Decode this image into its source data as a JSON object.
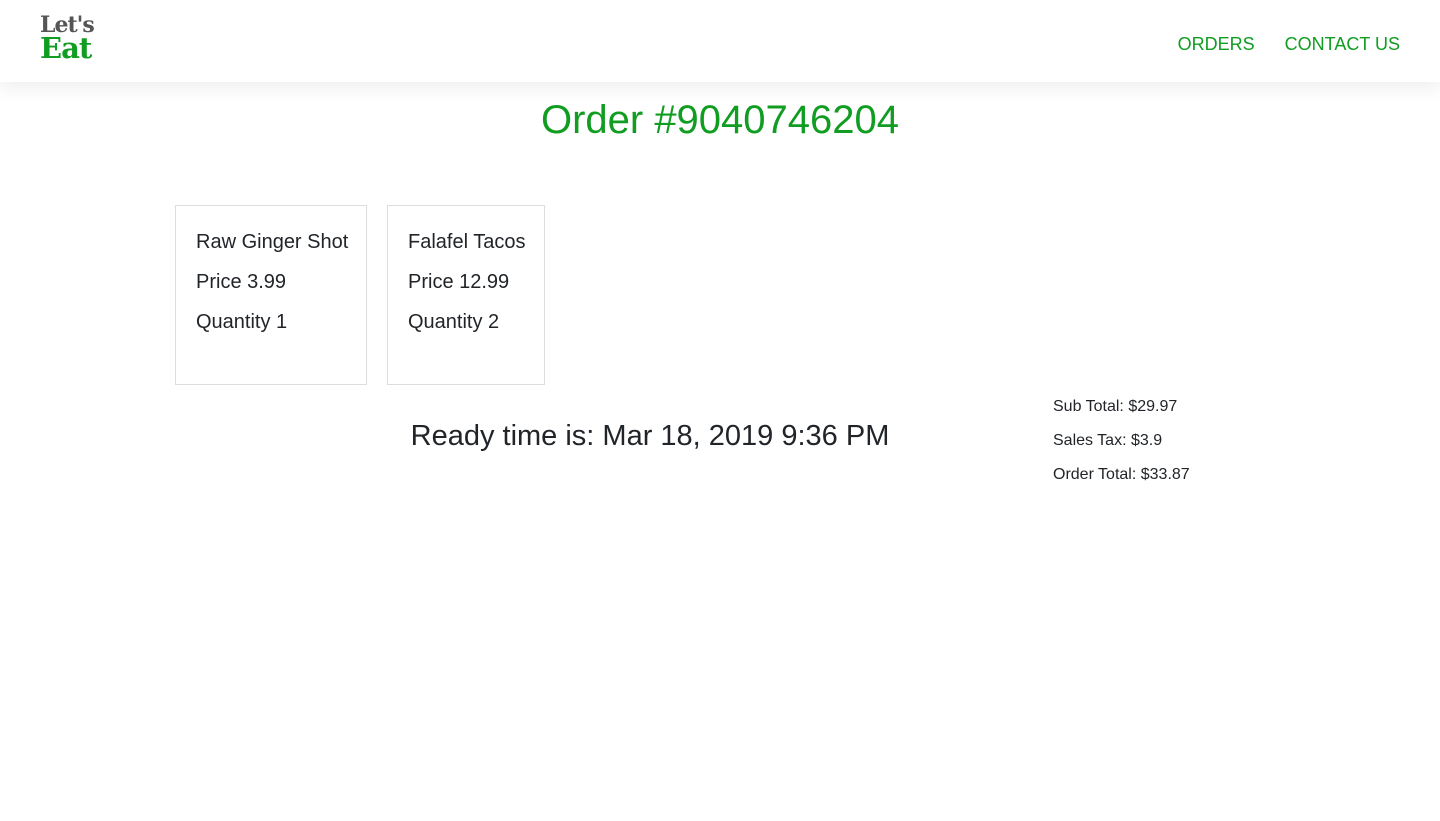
{
  "brand": {
    "logo_top": "Let's",
    "logo_bottom": "Eat"
  },
  "nav": {
    "items": [
      {
        "label": "ORDERS"
      },
      {
        "label": "CONTACT US"
      }
    ]
  },
  "order": {
    "title": "Order #9040746204",
    "items": [
      {
        "name": "Raw Ginger Shot",
        "price": "Price 3.99",
        "quantity": "Quantity 1"
      },
      {
        "name": "Falafel Tacos",
        "price": "Price 12.99",
        "quantity": "Quantity 2"
      }
    ],
    "ready_time": "Ready time is: Mar 18, 2019 9:36 PM",
    "totals": {
      "subtotal": "Sub Total: $29.97",
      "sales_tax": "Sales Tax: $3.9",
      "order_total": "Order Total: $33.87"
    }
  },
  "colors": {
    "accent": "#119c22",
    "logo_gray": "#555555",
    "text": "#212529",
    "card_border": "#dddddd"
  }
}
